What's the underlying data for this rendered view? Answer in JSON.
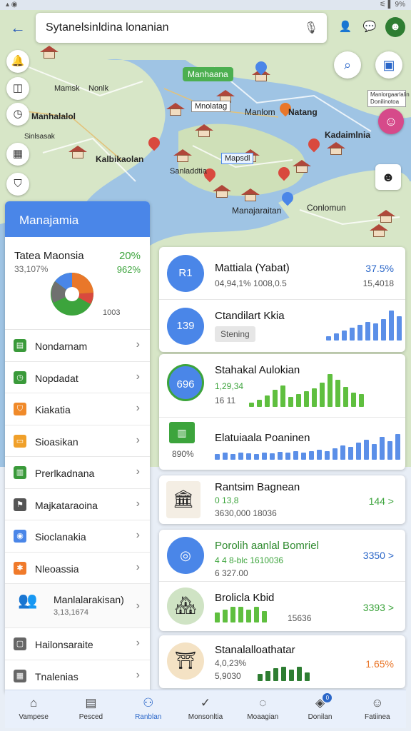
{
  "status_bar": {
    "left": "▴ ◉",
    "right": "⚟ ▌ 9%"
  },
  "search": {
    "value": "Sytanelsinldina lonanian"
  },
  "map": {
    "labels": [
      "Manhaana",
      "Mamsk",
      "Nonlk",
      "Manhalalol",
      "Sinlsasak",
      "Kalbikaolan",
      "Sanladdtia",
      "Mnolatag",
      "Manlom",
      "Natang",
      "Kadaimlnia",
      "Manajaraitan",
      "Conlomun",
      "Mapsdl"
    ],
    "fab_caption": "Manlorgaarlalin Donilinotoa"
  },
  "left_panel": {
    "header": "Manajamia",
    "overview": {
      "title": "Tatea Maonsia",
      "pct1": "20%",
      "sub": "33,107%",
      "pct2": "962%",
      "foot": "1003"
    },
    "menu": [
      {
        "label": "Nondarnam",
        "icon": "grid-icon",
        "color": "#3a9a3a"
      },
      {
        "label": "Nopdadat",
        "icon": "clock-icon",
        "color": "#3a9a3a"
      },
      {
        "label": "Kiakatia",
        "icon": "shield-icon",
        "color": "#f08a2a"
      },
      {
        "label": "Sioasikan",
        "icon": "tag-icon",
        "color": "#f0a02a"
      },
      {
        "label": "Prerlkadnana",
        "icon": "chart-icon",
        "color": "#3a9a3a"
      },
      {
        "label": "Majkataraoina",
        "icon": "flag-icon",
        "color": "#555555"
      },
      {
        "label": "Sioclanakia",
        "icon": "coin-icon",
        "color": "#4a86e8"
      },
      {
        "label": "Nleoassia",
        "icon": "star-icon",
        "color": "#f07a2a"
      },
      {
        "label": "Manlalarakisan)",
        "sub": "3,13,1674",
        "icon": "people-icon",
        "tall": true
      },
      {
        "label": "Hailonsaraite",
        "icon": "document-icon",
        "color": "#666666"
      },
      {
        "label": "Tnalenias",
        "icon": "calendar-icon",
        "color": "#666666"
      }
    ]
  },
  "cards": {
    "c1": {
      "r1": {
        "circle": "R1",
        "title": "Mattiala (Yabat)",
        "sub": "04,94,1% 1008,0.5",
        "pct": "37.5%",
        "pct2": "15,4018"
      },
      "r2": {
        "circle": "139",
        "title": "Ctandilart Kkia",
        "badge": "Stening"
      }
    },
    "c2": {
      "r1": {
        "circle": "696",
        "title": "Stahakal Aulokian",
        "sub": "1,29,34",
        "sub2": "16 11"
      },
      "r2": {
        "title": "Elatuiaala Poaninen",
        "sub": "890%"
      }
    },
    "c3": {
      "title": "Rantsim Bagnean",
      "sub": "0 13,8",
      "sub2": "3630,000 18036",
      "pct": "144 >"
    },
    "c4": {
      "r1": {
        "title": "Porolih aanlal Bomriel",
        "sub": "4 4 8-blc 1610036",
        "sub2": "6 327.00",
        "pct": "3350 >"
      },
      "r2": {
        "title": "Brolicla Kbid",
        "sub": "15636",
        "pct": "3393 >"
      }
    },
    "c5": {
      "title": "Stanalalloathatar",
      "sub": "4,0,23%",
      "sub2": "5,9030",
      "pct": "1.65%"
    }
  },
  "bottom_nav": [
    {
      "label": "Vampese",
      "icon": "home-icon"
    },
    {
      "label": "Pesced",
      "icon": "list-icon"
    },
    {
      "label": "Ranblan",
      "icon": "person-pin-icon",
      "active": true
    },
    {
      "label": "Monsonltia",
      "icon": "check-circle-icon"
    },
    {
      "label": "Moaagian",
      "icon": "chat-icon"
    },
    {
      "label": "Donilan",
      "icon": "layers-icon",
      "badge": "0"
    },
    {
      "label": "Fatiinea",
      "icon": "account-icon"
    }
  ],
  "colors": {
    "accent": "#4a86e8",
    "green": "#3ca43c",
    "orange": "#e9772a",
    "map_land": "#d7e6c7",
    "map_water": "#9fc4e4"
  }
}
